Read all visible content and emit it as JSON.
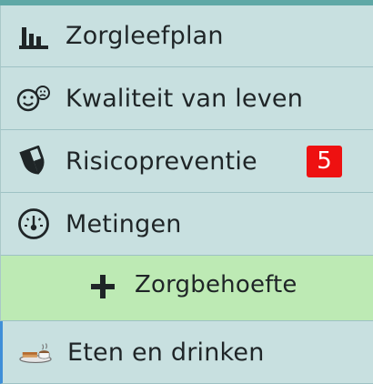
{
  "menu": {
    "items": [
      {
        "label": "Zorgleefplan",
        "icon": "bar-chart-icon"
      },
      {
        "label": "Kwaliteit van leven",
        "icon": "faces-icon"
      },
      {
        "label": "Risicopreventie",
        "icon": "shield-icon",
        "badge": "5"
      },
      {
        "label": "Metingen",
        "icon": "gauge-icon"
      }
    ],
    "add_section": {
      "label": "Zorgbehoefte",
      "icon": "plus-icon"
    },
    "sub_items": [
      {
        "label": "Eten en drinken",
        "icon": "food-tray-icon"
      }
    ]
  },
  "colors": {
    "background": "#c8e0e0",
    "top_bar": "#5fa8a6",
    "add_section_bg": "#bdeab4",
    "badge": "#ee1111",
    "active_border": "#3f8fd8"
  }
}
